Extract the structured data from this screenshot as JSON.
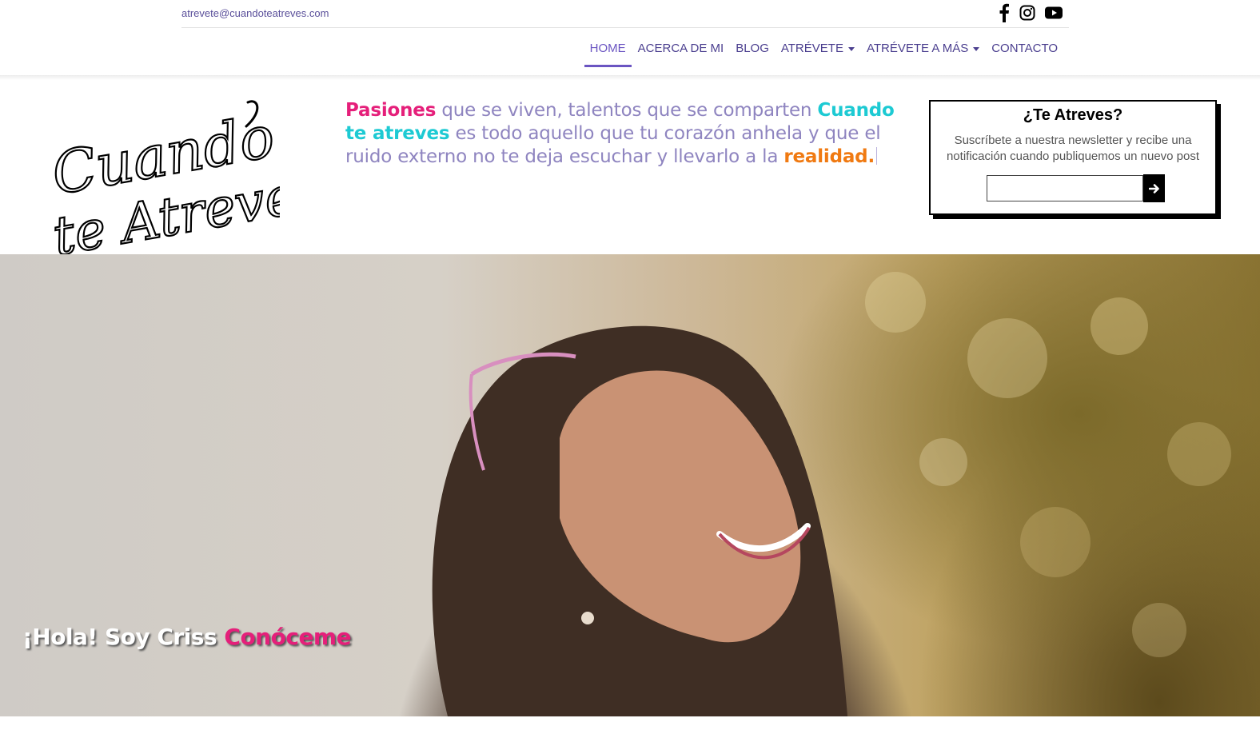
{
  "topbar": {
    "email": "atrevete@cuandoteatreves.com",
    "social_icons": [
      "facebook-icon",
      "instagram-icon",
      "youtube-icon"
    ]
  },
  "nav": {
    "items": [
      {
        "label": "HOME",
        "active": true,
        "dropdown": false
      },
      {
        "label": "ACERCA DE MI",
        "active": false,
        "dropdown": false
      },
      {
        "label": "BLOG",
        "active": false,
        "dropdown": false
      },
      {
        "label": "ATRÉVETE",
        "active": false,
        "dropdown": true
      },
      {
        "label": "ATRÉVETE A MÁS",
        "active": false,
        "dropdown": true
      },
      {
        "label": "CONTACTO",
        "active": false,
        "dropdown": false
      }
    ]
  },
  "logo": {
    "line1": "Cuando",
    "line2": "te Atreves"
  },
  "tagline": {
    "part1": "Pasiones",
    "part2": " que se viven, talentos que se comparten ",
    "part3": "Cuando te atreves",
    "part4": " es todo aquello que tu corazón anhela y que el ruido externo no te deja escuchar y llevarlo a la ",
    "part5": "realidad."
  },
  "newsletter": {
    "title": "¿Te Atreves?",
    "text": "Suscríbete a nuestra newsletter y recibe una notificación cuando publiquemos un nuevo post",
    "input_value": "",
    "submit_icon": "arrow-right-icon"
  },
  "hero": {
    "greeting": "¡Hola! Soy Criss ",
    "link": "Conóceme"
  },
  "colors": {
    "pink": "#e51f7a",
    "cyan": "#1dcad3",
    "orange": "#f07a12",
    "nav_purple": "#4b3f8f",
    "tagline_gray": "#8f85c0"
  }
}
